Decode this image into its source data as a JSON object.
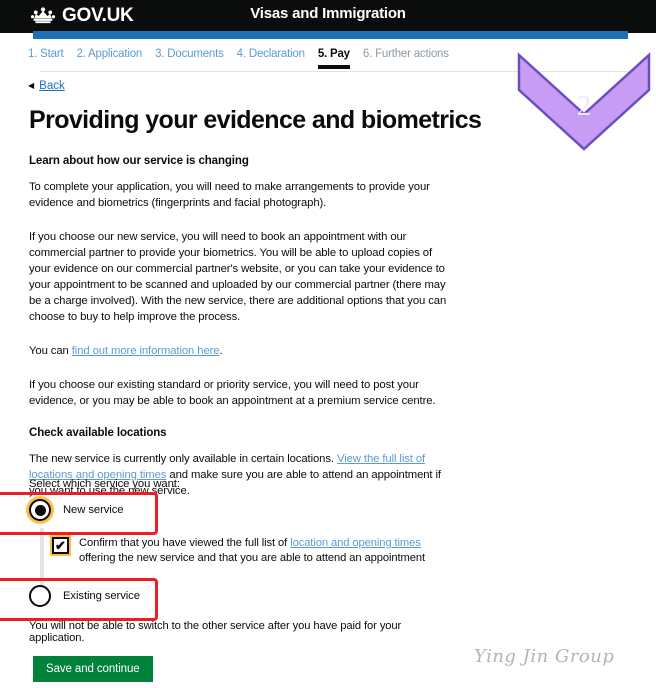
{
  "header": {
    "brand": "GOV.UK",
    "crown_icon": "crown-icon",
    "service_name": "Visas and Immigration"
  },
  "step_nav": {
    "steps": [
      {
        "label": "1. Start",
        "state": "link"
      },
      {
        "label": "2. Application",
        "state": "link"
      },
      {
        "label": "3. Documents",
        "state": "link"
      },
      {
        "label": "4. Declaration",
        "state": "link"
      },
      {
        "label": "5. Pay",
        "state": "active"
      },
      {
        "label": "6. Further actions",
        "state": "upcoming"
      }
    ]
  },
  "back": {
    "arrow": "◀",
    "label": "Back"
  },
  "page": {
    "title": "Providing your evidence and biometrics"
  },
  "content": {
    "subhead_service": "Learn about how our service is changing",
    "para_1": "To complete your application, you will need to make arrangements to provide your evidence and biometrics (fingerprints and facial photograph).",
    "para_2": "If you choose our new service, you will need to book an appointment with our commercial partner to provide your biometrics. You will be able to upload copies of your evidence on our commercial partner's website, or you can take your evidence to your appointment to be scanned and uploaded by our commercial partner (there may be a charge involved). With the new service, there are additional options that you can choose to buy to help improve the process.",
    "para_3_prefix": "You can ",
    "para_3_link": "find out more information here",
    "para_3_suffix": ".",
    "para_4": "If you choose our existing standard or priority service, you will need to post your evidence, or you may be able to book an appointment at a premium service centre.",
    "subhead_locations": "Check available locations",
    "para_5_prefix": "The new service is currently only available in certain locations. ",
    "para_5_link": "View the full list of locations and opening times",
    "para_5_suffix": " and make sure you are able to attend an appointment if you want to use the new service."
  },
  "selection": {
    "label": "Select which service you want:",
    "new_service": {
      "label": "New service",
      "selected": true
    },
    "existing_service": {
      "label": "Existing service",
      "selected": false
    },
    "confirm_checkbox": {
      "checked": true,
      "check_glyph": "✔",
      "text_prefix": "Confirm that you have viewed the full list of ",
      "link": "location and opening times",
      "text_suffix": " offering the new service and that you are able to attend an appointment"
    },
    "switch_warning": "You will not be able to switch to the other service after you have paid for your application."
  },
  "actions": {
    "save_label": "Save and continue"
  },
  "annotations": {
    "chevron": {
      "number": "2",
      "fill": "#c79cf5",
      "stroke": "#6b4fc0"
    },
    "highlight_color": "#ee1c25"
  },
  "watermark": {
    "text": "Ying Jin Group"
  },
  "colors": {
    "header_bg": "#0b0c0c",
    "blue_bar": "#1d70b8",
    "link": "#5b9bd5",
    "button_green": "#00823b",
    "focus_yellow": "#ffbf47"
  }
}
